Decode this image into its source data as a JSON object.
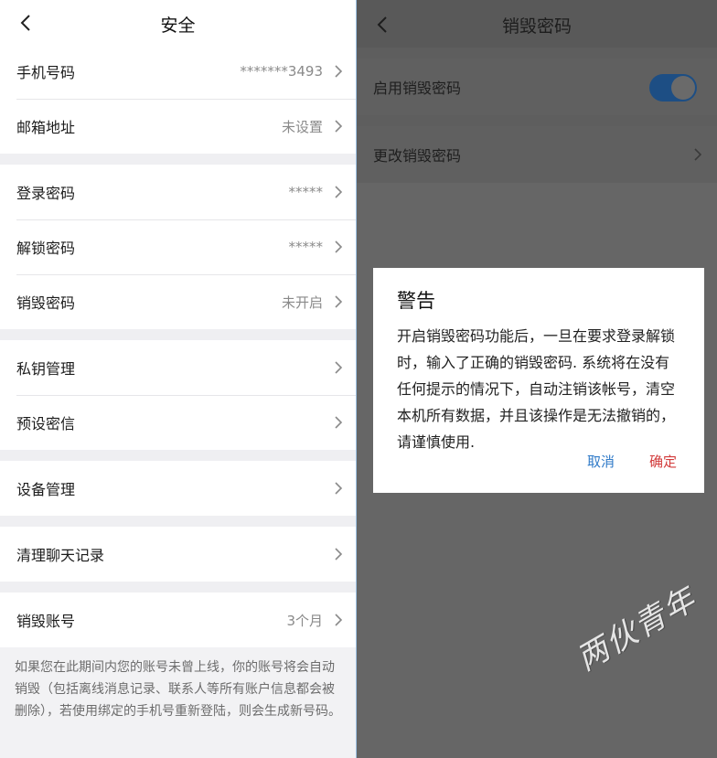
{
  "left": {
    "title": "安全",
    "groups": [
      [
        {
          "label": "手机号码",
          "value": "*******3493"
        },
        {
          "label": "邮箱地址",
          "value": "未设置"
        }
      ],
      [
        {
          "label": "登录密码",
          "value": "*****"
        },
        {
          "label": "解锁密码",
          "value": "*****"
        },
        {
          "label": "销毁密码",
          "value": "未开启"
        }
      ],
      [
        {
          "label": "私钥管理",
          "value": ""
        },
        {
          "label": "预设密信",
          "value": ""
        }
      ],
      [
        {
          "label": "设备管理",
          "value": ""
        }
      ],
      [
        {
          "label": "清理聊天记录",
          "value": ""
        }
      ],
      [
        {
          "label": "销毁账号",
          "value": "3个月"
        }
      ]
    ],
    "note": "如果您在此期间内您的账号未曾上线，你的账号将会自动销毁（包括离线消息记录、联系人等所有账户信息都会被删除），若使用绑定的手机号重新登陆，则会生成新号码。"
  },
  "right": {
    "title": "销毁密码",
    "enable_label": "启用销毁密码",
    "enable_on": true,
    "change_label": "更改销毁密码",
    "dialog": {
      "title": "警告",
      "body": "开启销毁密码功能后，一旦在要求登录解锁时，输入了正确的销毁密码. 系统将在没有任何提示的情况下，自动注销该帐号，清空本机所有数据，并且该操作是无法撤销的，请谨慎使用.",
      "cancel": "取消",
      "confirm": "确定"
    }
  },
  "watermark": "两伙青年",
  "colors": {
    "accent": "#2f7ac8",
    "danger": "#d23a3a",
    "toggle_on": "#1d4e84"
  }
}
